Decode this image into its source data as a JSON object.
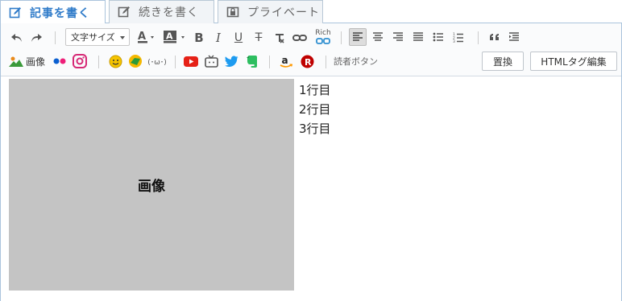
{
  "tabs": [
    {
      "label": "記事を書く",
      "icon": "edit-icon",
      "active": true
    },
    {
      "label": "続きを書く",
      "icon": "edit-continue-icon",
      "active": false
    },
    {
      "label": "プライベート",
      "icon": "lock-icon",
      "active": false
    }
  ],
  "toolbar": {
    "font_size_label": "文字サイズ",
    "rich_label": "Rich",
    "image_label": "画像",
    "emoticon_label": "(･ω･)",
    "reader_button_label": "読者ボタン",
    "replace_button": "置換",
    "html_edit_button": "HTMLタグ編集"
  },
  "content": {
    "placeholder_label": "画像",
    "lines": [
      "1行目",
      "2行目",
      "3行目"
    ]
  },
  "colors": {
    "accent": "#2f7bc9",
    "placeholder": "#c4c4c4"
  }
}
